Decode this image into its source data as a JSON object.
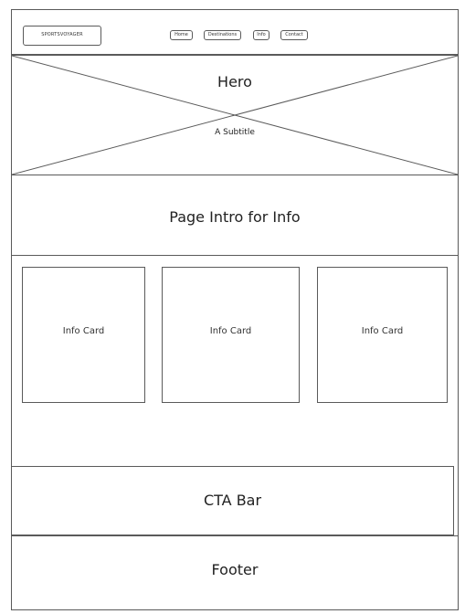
{
  "header": {
    "logo_text": "SPORTSVOYAGER",
    "nav": [
      {
        "label": "Home"
      },
      {
        "label": "Destinations"
      },
      {
        "label": "Info"
      },
      {
        "label": "Contact"
      }
    ]
  },
  "hero": {
    "title": "Hero",
    "subtitle": "A Subtitle"
  },
  "intro": {
    "title": "Page Intro for Info"
  },
  "cards": [
    {
      "label": "Info Card"
    },
    {
      "label": "Info Card"
    },
    {
      "label": "Info Card"
    }
  ],
  "cta": {
    "label": "CTA Bar"
  },
  "footer": {
    "label": "Footer"
  }
}
